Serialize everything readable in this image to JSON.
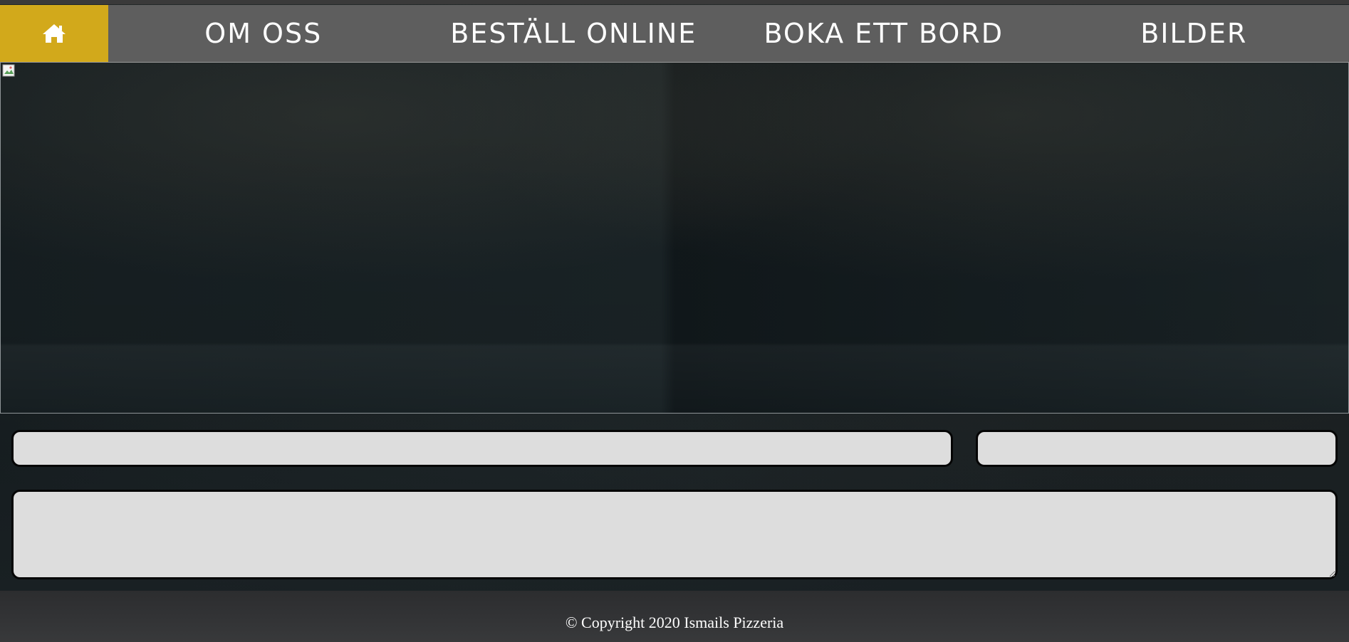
{
  "nav": {
    "home_icon": "home-icon",
    "items": [
      {
        "label": "OM OSS"
      },
      {
        "label": "BESTÄLL ONLINE"
      },
      {
        "label": "BOKA ETT BORD"
      },
      {
        "label": "BILDER"
      }
    ]
  },
  "hero": {
    "image_icon": "broken-image-icon"
  },
  "form": {
    "field_one": "",
    "field_two": "",
    "field_three": ""
  },
  "footer": {
    "copyright": "© Copyright 2020 Ismails Pizzeria"
  },
  "colors": {
    "accent": "#d2a91b",
    "nav_background": "#5e5e5e",
    "field_background": "#dddddd",
    "footer_background": "#333436"
  }
}
